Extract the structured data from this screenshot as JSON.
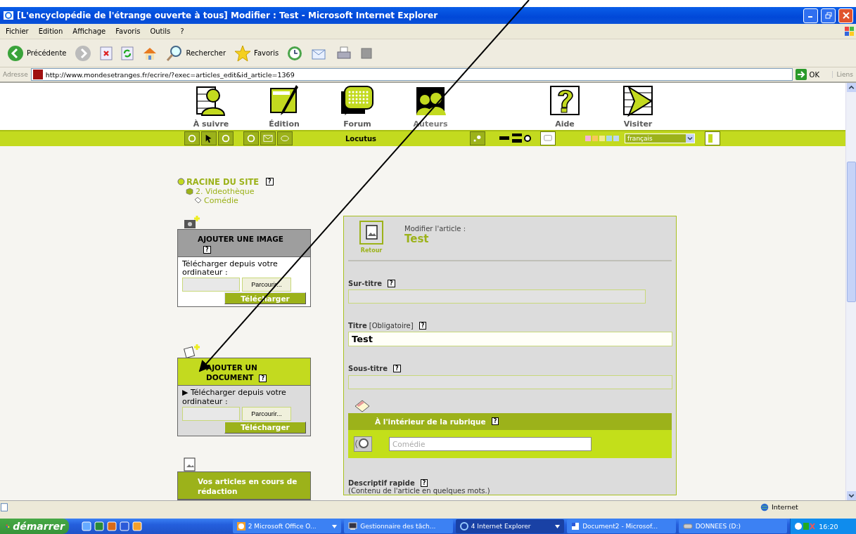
{
  "window": {
    "title": "[L'encyclopédie de l'étrange ouverte à tous] Modifier : Test - Microsoft Internet Explorer"
  },
  "menu": [
    "Fichier",
    "Edition",
    "Affichage",
    "Favoris",
    "Outils",
    "?"
  ],
  "toolbar": [
    {
      "kind": "back",
      "label": "Précédente"
    },
    {
      "kind": "forward"
    },
    {
      "kind": "stop"
    },
    {
      "kind": "refresh"
    },
    {
      "kind": "home"
    },
    {
      "kind": "search",
      "label": "Rechercher"
    },
    {
      "kind": "favorites",
      "label": "Favoris"
    },
    {
      "kind": "history"
    },
    {
      "kind": "mail"
    },
    {
      "kind": "print"
    },
    {
      "kind": "edit"
    }
  ],
  "address": {
    "label": "Adresse",
    "url": "http://www.mondesetranges.fr/ecrire/?exec=articles_edit&id_article=1369",
    "go": "OK",
    "links": "Liens"
  },
  "nav": [
    {
      "kind": "follow",
      "label": "À suivre",
      "selected": false
    },
    {
      "kind": "edit",
      "label": "Édition",
      "selected": false
    },
    {
      "kind": "forum",
      "label": "Forum",
      "selected": false
    },
    {
      "kind": "authors",
      "label": "Auteurs",
      "selected": true
    },
    {
      "kind": "help",
      "label": "Aide",
      "selected": false
    },
    {
      "kind": "visit",
      "label": "Visiter",
      "selected": false
    }
  ],
  "subbar": {
    "user": "Locutus",
    "language": "français"
  },
  "breadcrumb": [
    {
      "label": "RACINE DU SITE",
      "help": "?",
      "children": [
        {
          "label": "2. Videothèque",
          "children": [
            {
              "label": "Comédie"
            }
          ]
        }
      ]
    }
  ],
  "image_box": {
    "title": "AJOUTER UNE IMAGE",
    "help": "?",
    "text": "Télécharger depuis votre ordinateur :",
    "browse": "Parcourir...",
    "upload": "Télécharger"
  },
  "document_box": {
    "title": "AJOUTER UN DOCUMENT",
    "help": "?",
    "marker": "▶",
    "text": "Télécharger depuis votre ordinateur :",
    "browse": "Parcourir...",
    "upload": "Télécharger"
  },
  "articles_box": {
    "title": "Vos articles en cours de rédaction"
  },
  "form": {
    "back": "Retour",
    "heading": "Modifier l'article :",
    "article": "Test",
    "fields": [
      {
        "label": "Sur-titre",
        "help": "?",
        "required": false
      },
      {
        "label": "Titre",
        "note": "[Obligatoire]",
        "help": "?",
        "value": "Test",
        "required": true
      },
      {
        "label": "Sous-titre",
        "help": "?",
        "required": false
      }
    ],
    "section": {
      "title": "À l'intérieur de la rubrique",
      "help": "?",
      "placeholder": "Comédie"
    },
    "summary": {
      "label": "Descriptif rapide",
      "help": "?",
      "hint": "(Contenu de l'article en quelques mots.)"
    }
  },
  "status_bar": {
    "zone": "Internet"
  },
  "taskbar": {
    "start": "démarrer",
    "tasks": [
      {
        "label": "2 Microsoft Office O...",
        "kind": "office",
        "grouped": true,
        "selected": false
      },
      {
        "label": "Gestionnaire des tâch...",
        "kind": "monitor",
        "grouped": false,
        "selected": false
      },
      {
        "label": "4 Internet Explorer",
        "kind": "ie",
        "grouped": true,
        "selected": true
      },
      {
        "label": "Document2 - Microsof...",
        "kind": "word",
        "grouped": false,
        "selected": false
      },
      {
        "label": "DONNEES (D:)",
        "kind": "drive",
        "grouped": false,
        "selected": false
      }
    ],
    "clock": "16:20"
  }
}
